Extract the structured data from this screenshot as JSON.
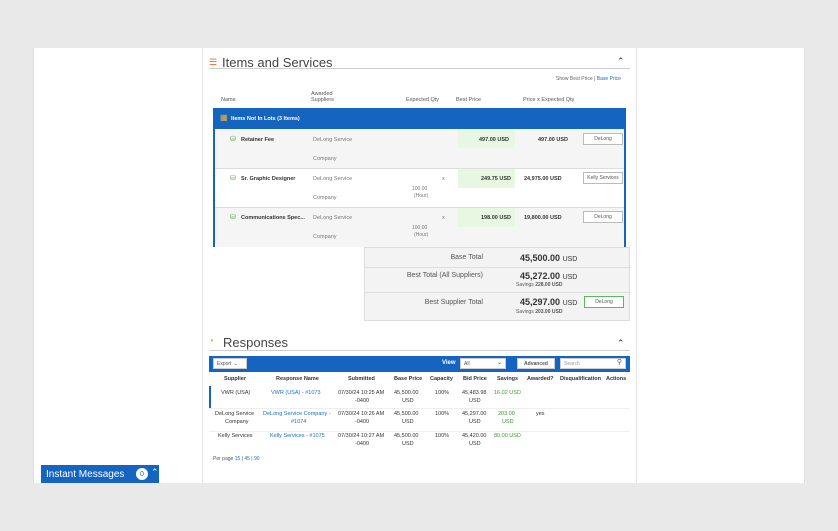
{
  "items_section": {
    "title": "Items and Services",
    "show_best_price": "Show Best Price",
    "separator": "|",
    "base_price_link": "Base Price",
    "columns": {
      "name": "Name",
      "awarded": "Awarded",
      "suppliers": "Suppliers",
      "expected_qty": "Expected Qty",
      "best_price": "Best Price",
      "price_x_qty": "Price x Expected Qty"
    },
    "group_label": "Items Not In Lots (3 Items)",
    "items": [
      {
        "name": "Retainer Fee",
        "supplier_l1": "DeLong Service",
        "supplier_l2": "Company",
        "best_price": "497.00 USD",
        "total": "497.00 USD",
        "button": "DeLong",
        "qty_l1": "",
        "qty_l2": "",
        "x": ""
      },
      {
        "name": "Sr. Graphic Designer",
        "supplier_l1": "DeLong Service",
        "supplier_l2": "Company",
        "best_price": "249.75 USD",
        "total": "24,975.00 USD",
        "button": "Kelly Services",
        "qty_l1": "100.00",
        "qty_l2": "(Hour)",
        "x": "x"
      },
      {
        "name": "Communications Spec...",
        "supplier_l1": "DeLong Service",
        "supplier_l2": "Company",
        "best_price": "198.00 USD",
        "total": "19,800.00 USD",
        "button": "DeLong",
        "qty_l1": "100.00",
        "qty_l2": "(Hour)",
        "x": "x"
      }
    ],
    "totals": [
      {
        "label": "Base Total",
        "value": "45,500.00",
        "unit": "USD",
        "savings_label": "",
        "savings": ""
      },
      {
        "label": "Best Total (All Suppliers)",
        "value": "45,272.00",
        "unit": "USD",
        "savings_label": "Savings",
        "savings": "228.00 USD"
      },
      {
        "label": "Best Supplier Total",
        "value": "45,297.00",
        "unit": "USD",
        "savings_label": "Savings",
        "savings": "203.00 USD",
        "button": "DeLong"
      }
    ]
  },
  "responses_section": {
    "title": "Responses",
    "export_label": "Export",
    "view_label": "View",
    "view_value": "All",
    "advanced_label": "Advanced",
    "search_placeholder": "Search",
    "columns": [
      "Supplier",
      "Response Name",
      "Submitted",
      "Base Price",
      "Capacity",
      "Bid Price",
      "Savings",
      "Awarded?",
      "Disqualification",
      "Actions"
    ],
    "rows": [
      {
        "supplier_l1": "VWR (USA)",
        "supplier_l2": "",
        "response_l1": "VWR (USA) - #1073",
        "response_l2": "",
        "submitted_l1": "07/30/24 10:25 AM",
        "submitted_l2": "-0400",
        "base_l1": "45,500.00",
        "base_l2": "USD",
        "capacity": "100%",
        "bid_l1": "45,483.98",
        "bid_l2": "USD",
        "savings_l1": "16.02 USD",
        "savings_l2": "",
        "awarded": ""
      },
      {
        "supplier_l1": "DeLong Service",
        "supplier_l2": "Company",
        "response_l1": "DeLong Service Company -",
        "response_l2": "#1074",
        "submitted_l1": "07/30/24 10:26 AM",
        "submitted_l2": "-0400",
        "base_l1": "45,500.00",
        "base_l2": "USD",
        "capacity": "100%",
        "bid_l1": "45,297.00",
        "bid_l2": "USD",
        "savings_l1": "203.00",
        "savings_l2": "USD",
        "awarded": "yes"
      },
      {
        "supplier_l1": "Kelly Services",
        "supplier_l2": "",
        "response_l1": "Kelly Services - #1075",
        "response_l2": "",
        "submitted_l1": "07/30/24 10:27 AM",
        "submitted_l2": "-0400",
        "base_l1": "45,500.00",
        "base_l2": "USD",
        "capacity": "100%",
        "bid_l1": "45,420.00",
        "bid_l2": "USD",
        "savings_l1": "80.00 USD",
        "savings_l2": "",
        "awarded": ""
      }
    ],
    "per_page_label": "Per page",
    "per_page_options": [
      "15",
      "45",
      "90"
    ],
    "pp_sep": "|"
  },
  "instant_messages": {
    "label": "Instant Messages",
    "count": "0"
  },
  "colors": {
    "primary_blue": "#1565c0",
    "savings_green": "#3c9a2e",
    "best_price_bg": "#e8f7e2"
  }
}
